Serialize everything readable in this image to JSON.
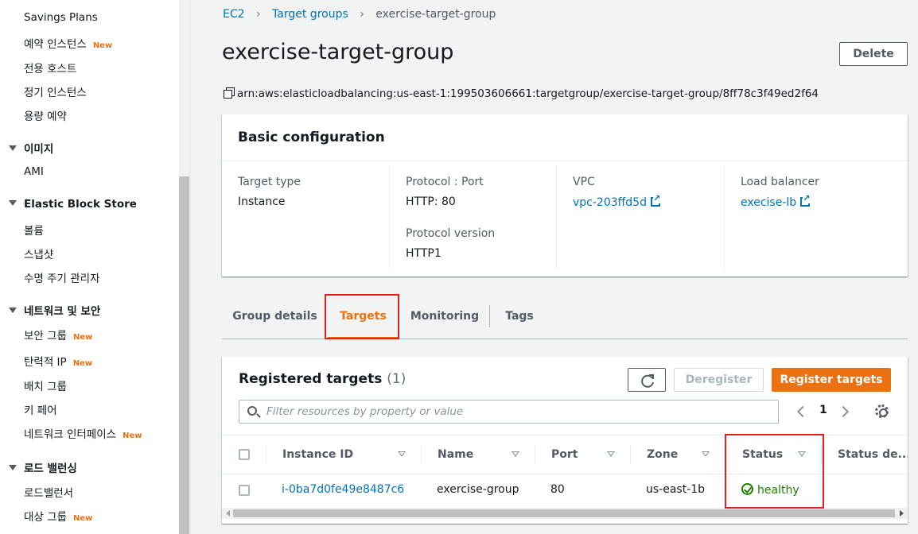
{
  "sidebar": {
    "items_top": [
      {
        "label": "Savings Plans",
        "badge": ""
      },
      {
        "label": "예약 인스턴스",
        "badge": "New"
      },
      {
        "label": "전용 호스트",
        "badge": ""
      },
      {
        "label": "정기 인스턴스",
        "badge": ""
      },
      {
        "label": "용량 예약",
        "badge": ""
      }
    ],
    "section_images": "이미지",
    "item_ami": "AMI",
    "section_ebs": "Elastic Block Store",
    "ebs_items": [
      "볼륨",
      "스냅샷",
      "수명 주기 관리자"
    ],
    "section_network": "네트워크 및 보안",
    "network_items": [
      {
        "label": "보안 그룹",
        "badge": "New"
      },
      {
        "label": "탄력적 IP",
        "badge": "New"
      },
      {
        "label": "배치 그룹",
        "badge": ""
      },
      {
        "label": "키 페어",
        "badge": ""
      },
      {
        "label": "네트워크 인터페이스",
        "badge": "New"
      }
    ],
    "section_lb": "로드 밸런싱",
    "lb_items": [
      {
        "label": "로드밸런서",
        "badge": ""
      },
      {
        "label": "대상 그룹",
        "badge": "New"
      }
    ]
  },
  "breadcrumb": {
    "ec2": "EC2",
    "target_groups": "Target groups",
    "current": "exercise-target-group"
  },
  "page": {
    "title": "exercise-target-group",
    "delete_label": "Delete",
    "arn": "arn:aws:elasticloadbalancing:us-east-1:199503606661:targetgroup/exercise-target-group/8ff78c3f49ed2f64"
  },
  "basic_config": {
    "title": "Basic configuration",
    "target_type_label": "Target type",
    "target_type_value": "Instance",
    "protocol_port_label": "Protocol : Port",
    "protocol_port_value": "HTTP: 80",
    "protocol_version_label": "Protocol version",
    "protocol_version_value": "HTTP1",
    "vpc_label": "VPC",
    "vpc_value": "vpc-203ffd5d",
    "lb_label": "Load balancer",
    "lb_value": "execise-lb"
  },
  "tabs": [
    "Group details",
    "Targets",
    "Monitoring",
    "Tags"
  ],
  "targets": {
    "title": "Registered targets",
    "count": "(1)",
    "deregister_label": "Deregister",
    "register_label": "Register targets",
    "search_placeholder": "Filter resources by property or value",
    "page_number": "1",
    "columns": [
      "Instance ID",
      "Name",
      "Port",
      "Zone",
      "Status",
      "Status de..."
    ],
    "rows": [
      {
        "instance_id": "i-0ba7d0fe49e8487c6",
        "name": "exercise-group",
        "port": "80",
        "zone": "us-east-1b",
        "status": "healthy"
      }
    ]
  },
  "colors": {
    "accent": "#ec7211",
    "link": "#0073bb",
    "healthy": "#1d8102",
    "highlight": "#e0201f"
  }
}
